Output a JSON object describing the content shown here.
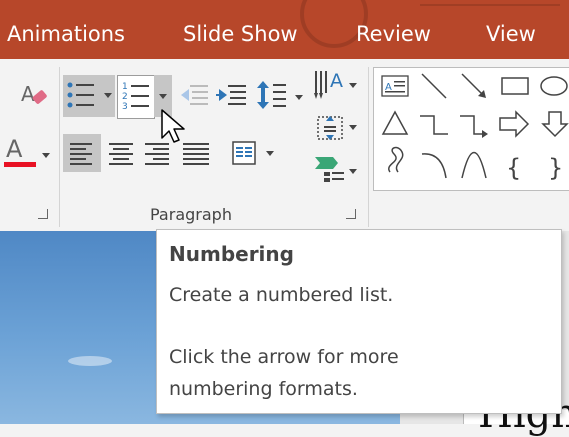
{
  "tabs": [
    {
      "label": "Animations"
    },
    {
      "label": "Slide Show"
    },
    {
      "label": "Review"
    },
    {
      "label": "View"
    }
  ],
  "ribbon": {
    "paragraph_group_label": "Paragraph",
    "font_color_accent": "#e81123",
    "tab_color": "#b7472a",
    "icons": [
      "clear-formatting-icon",
      "font-color-icon",
      "bullets-icon",
      "numbering-icon",
      "decrease-indent-icon",
      "increase-indent-icon",
      "line-spacing-icon",
      "text-direction-icon",
      "align-text-icon",
      "convert-to-smartart-icon",
      "align-left-icon",
      "center-icon",
      "align-right-icon",
      "justify-icon",
      "columns-icon"
    ]
  },
  "tooltip": {
    "title": "Numbering",
    "line1": "Create a numbered list.",
    "line2": "Click the arrow for more",
    "line3": "numbering formats."
  },
  "slide": {
    "text_fragment": "High"
  }
}
